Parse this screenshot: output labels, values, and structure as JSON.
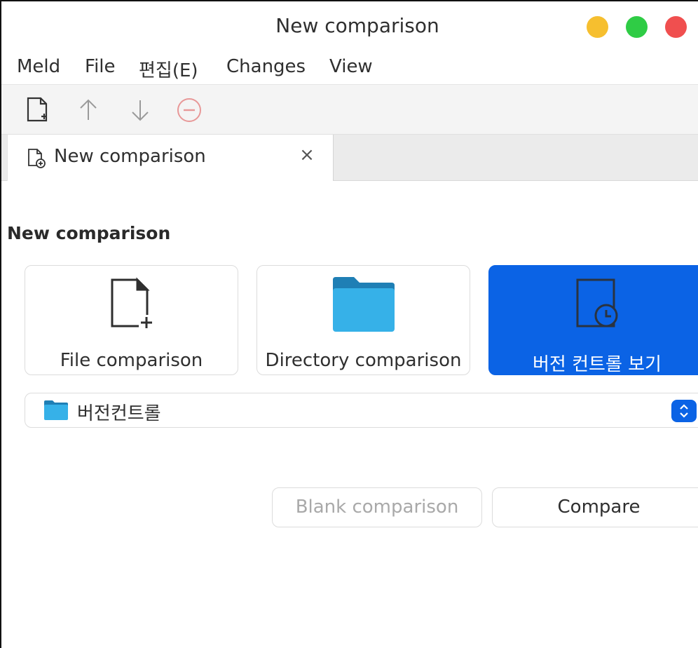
{
  "window": {
    "title": "New comparison"
  },
  "menubar": {
    "items": [
      "Meld",
      "File",
      "편집(E)",
      "Changes",
      "View"
    ]
  },
  "toolbar": {
    "buttons": [
      {
        "icon": "new-document-icon"
      },
      {
        "icon": "arrow-up-icon"
      },
      {
        "icon": "arrow-down-icon"
      },
      {
        "icon": "stop-icon"
      }
    ]
  },
  "tabs": [
    {
      "label": "New comparison",
      "icon": "new-document-icon",
      "close": "×"
    }
  ],
  "main": {
    "heading": "New comparison",
    "cards": [
      {
        "label": "File comparison",
        "icon": "new-file-icon",
        "selected": false
      },
      {
        "label": "Directory comparison",
        "icon": "folder-icon",
        "selected": false
      },
      {
        "label": "버전 컨트롤 보기",
        "icon": "version-control-icon",
        "selected": true
      }
    ],
    "vc_chooser": {
      "value": "버전컨트롤",
      "icon": "folder-icon"
    },
    "buttons": {
      "blank": "Blank comparison",
      "compare": "Compare"
    }
  },
  "colors": {
    "accent": "#0b63e5",
    "traffic_minimize": "#f6bf2f",
    "traffic_maximize": "#2fcc45",
    "traffic_close": "#f04f4f",
    "folder": "#36b1e8"
  }
}
